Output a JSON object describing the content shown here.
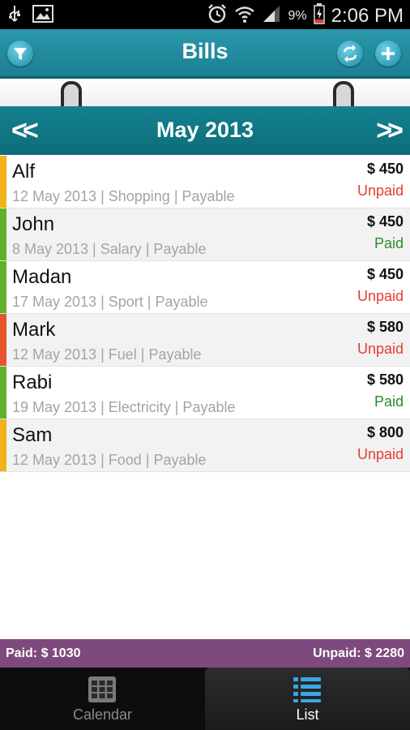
{
  "status_bar": {
    "time": "2:06 PM",
    "battery": "9%"
  },
  "header": {
    "title": "Bills"
  },
  "month": {
    "label": "May 2013",
    "prev": "<<",
    "next": ">>"
  },
  "bills": [
    {
      "name": "Alf",
      "meta": "12 May 2013 | Shopping | Payable",
      "amount": "$ 450",
      "status": "Unpaid",
      "color": "#f2b21a",
      "status_color": "#e53d2d"
    },
    {
      "name": "John",
      "meta": "8 May 2013 | Salary | Payable",
      "amount": "$ 450",
      "status": "Paid",
      "color": "#62b02a",
      "status_color": "#2c8a28"
    },
    {
      "name": "Madan",
      "meta": "17 May 2013 | Sport | Payable",
      "amount": "$ 450",
      "status": "Unpaid",
      "color": "#62b02a",
      "status_color": "#e53d2d"
    },
    {
      "name": "Mark",
      "meta": "12 May 2013 | Fuel | Payable",
      "amount": "$ 580",
      "status": "Unpaid",
      "color": "#e4552b",
      "status_color": "#e53d2d"
    },
    {
      "name": "Rabi",
      "meta": "19 May 2013 | Electricity | Payable",
      "amount": "$ 580",
      "status": "Paid",
      "color": "#62b02a",
      "status_color": "#2c8a28"
    },
    {
      "name": "Sam",
      "meta": "12 May 2013 | Food | Payable",
      "amount": "$ 800",
      "status": "Unpaid",
      "color": "#f2b21a",
      "status_color": "#e53d2d"
    }
  ],
  "totals": {
    "paid": "Paid: $ 1030",
    "unpaid": "Unpaid: $ 2280"
  },
  "tabs": [
    {
      "label": "Calendar",
      "icon": "calendar-grid-icon",
      "selected": false
    },
    {
      "label": "List",
      "icon": "list-icon",
      "selected": true
    }
  ],
  "colors": {
    "header": "#1f8a9e",
    "totals_bar": "#7e4a7d",
    "accent_blue": "#3aa6e6"
  }
}
